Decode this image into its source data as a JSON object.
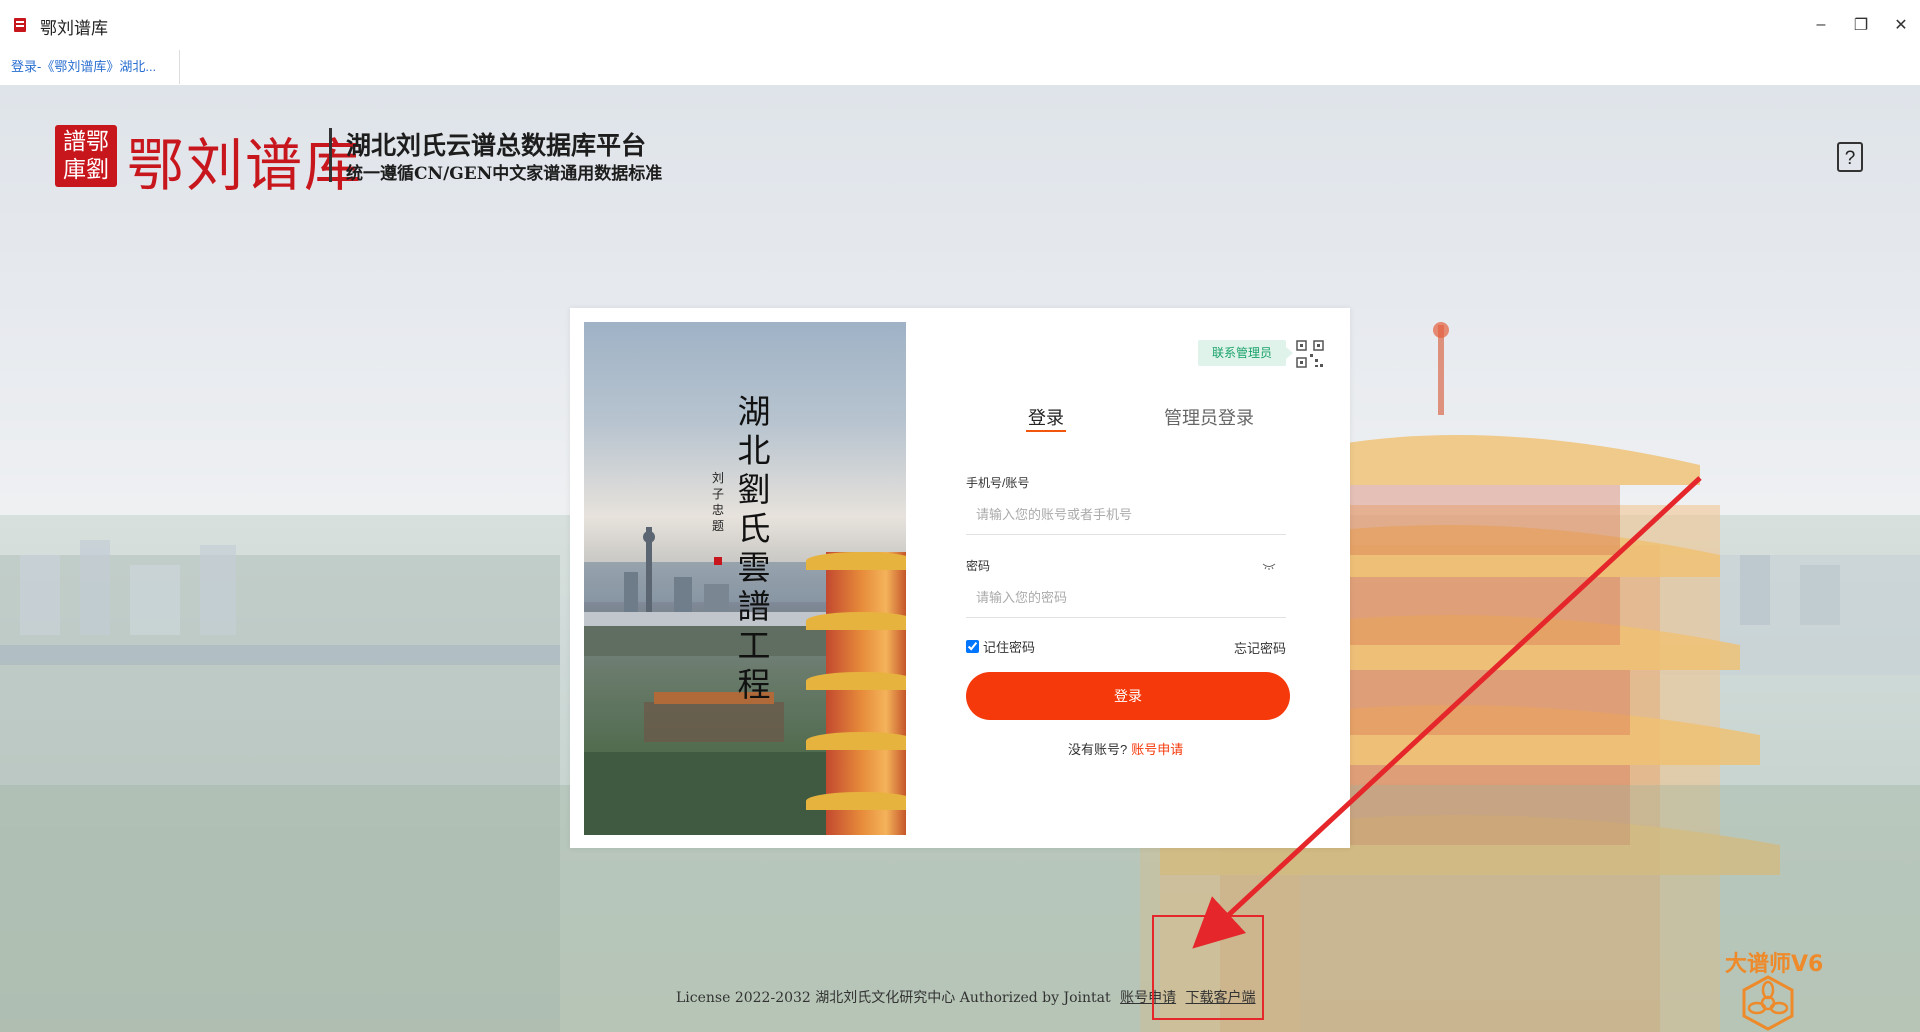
{
  "window": {
    "title": "鄂刘谱库",
    "tab_label": "登录-《鄂刘谱库》湖北...",
    "minimize": "–",
    "restore": "❐",
    "close": "✕"
  },
  "header": {
    "seal_text": "譜鄂庫劉",
    "brand_name": "鄂刘谱库",
    "platform_title": "湖北刘氏云谱总数据库平台",
    "platform_subtitle": "统一遵循CN/GEN中文家谱通用数据标准",
    "help_label": "?"
  },
  "poster": {
    "calligraphy": "湖北劉氏雲譜工程",
    "inscription": "刘子忠题"
  },
  "login": {
    "contact_admin": "联系管理员",
    "tabs": [
      "登录",
      "管理员登录"
    ],
    "account_label": "手机号/账号",
    "account_placeholder": "请输入您的账号或者手机号",
    "password_label": "密码",
    "password_placeholder": "请输入您的密码",
    "remember_label": "记住密码",
    "remember_checked": true,
    "forgot_label": "忘记密码",
    "submit_label": "登录",
    "no_account_text": "没有账号?",
    "apply_link": "账号申请"
  },
  "footer": {
    "license_text": "License 2022-2032 湖北刘氏文化研究中心 Authorized by Jointat",
    "apply_link": "账号申请",
    "download_link": "下载客户端"
  },
  "corner_logo": {
    "text": "大谱师V6"
  },
  "colors": {
    "brand_red": "#c8161d",
    "accent_orange": "#f5390a",
    "admin_tag_green": "#1aa26a",
    "annotation_red": "#e5262a"
  }
}
